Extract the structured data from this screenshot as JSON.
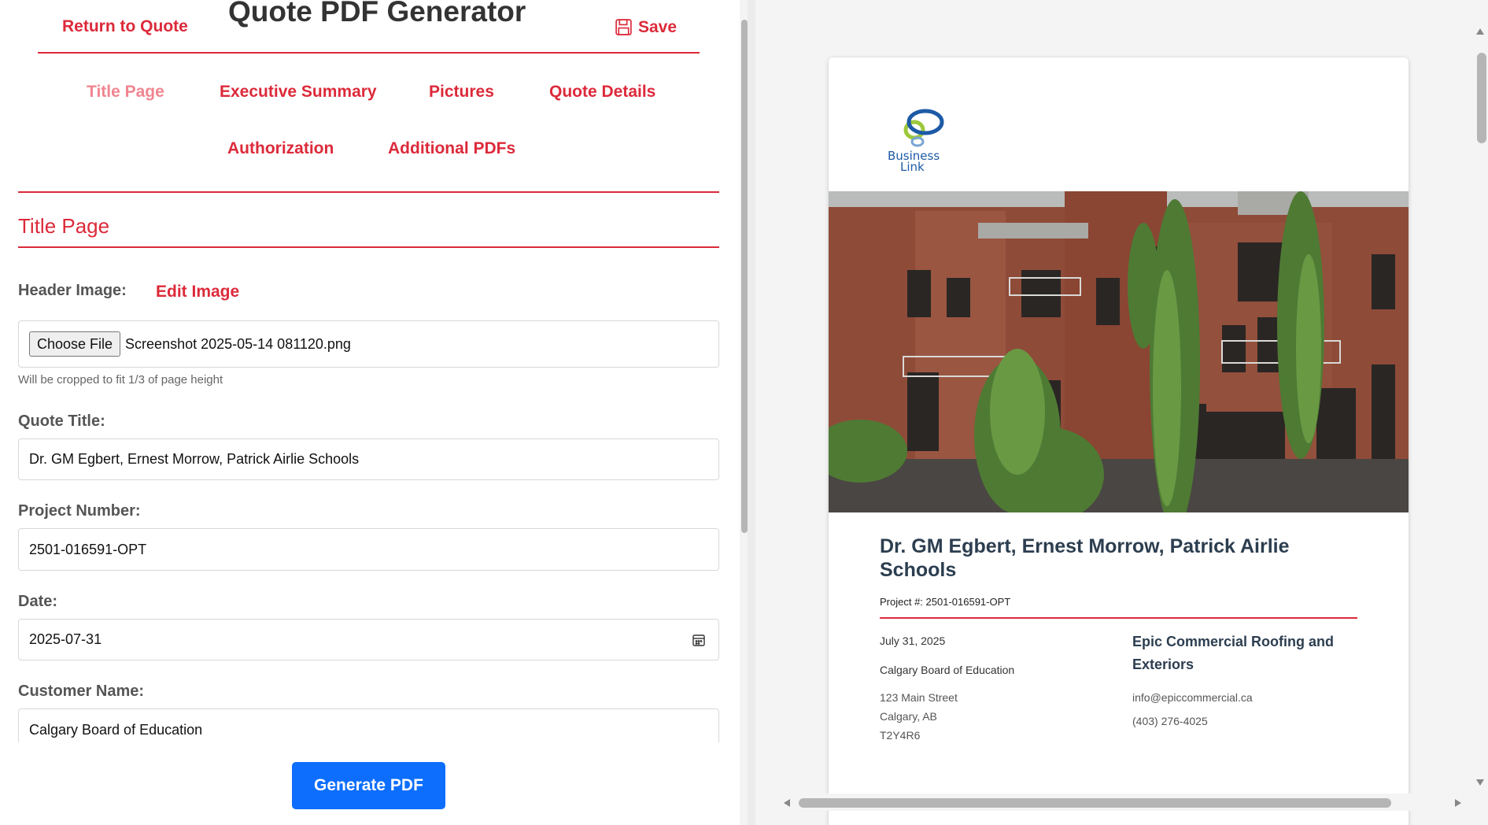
{
  "header": {
    "return_label": "Return to Quote",
    "title": "Quote PDF Generator",
    "save_label": "Save"
  },
  "tabs": [
    {
      "label": "Title Page",
      "active": true
    },
    {
      "label": "Executive Summary",
      "active": false
    },
    {
      "label": "Pictures",
      "active": false
    },
    {
      "label": "Quote Details",
      "active": false
    },
    {
      "label": "Authorization",
      "active": false
    },
    {
      "label": "Additional PDFs",
      "active": false
    }
  ],
  "section": {
    "title": "Title Page"
  },
  "form": {
    "header_image_label": "Header Image:",
    "edit_image_label": "Edit Image",
    "choose_file_label": "Choose File",
    "file_name": "Screenshot 2025-05-14 081120.png",
    "file_hint": "Will be cropped to fit 1/3 of page height",
    "quote_title_label": "Quote Title:",
    "quote_title_value": "Dr. GM Egbert, Ernest Morrow, Patrick Airlie Schools",
    "project_number_label": "Project Number:",
    "project_number_value": "2501-016591-OPT",
    "date_label": "Date:",
    "date_value": "2025-07-31",
    "customer_name_label": "Customer Name:",
    "customer_name_value": "Calgary Board of Education"
  },
  "generate_label": "Generate PDF",
  "preview": {
    "logo_text_1": "Business",
    "logo_text_2": "Link",
    "title": "Dr. GM Egbert, Ernest Morrow, Patrick Airlie Schools",
    "project_line": "Project #: 2501-016591-OPT",
    "date": "July 31, 2025",
    "customer": "Calgary Board of Education",
    "address_1": "123 Main Street",
    "address_2": "Calgary, AB",
    "address_3": "T2Y4R6",
    "company": "Epic Commercial Roofing and Exteriors",
    "email": "info@epiccommercial.ca",
    "phone": "(403) 276-4025"
  },
  "colors": {
    "accent": "#dc2a3a",
    "accent_light": "#f08590",
    "primary_button": "#0d6efd",
    "heading_dark": "#2c3e50"
  }
}
